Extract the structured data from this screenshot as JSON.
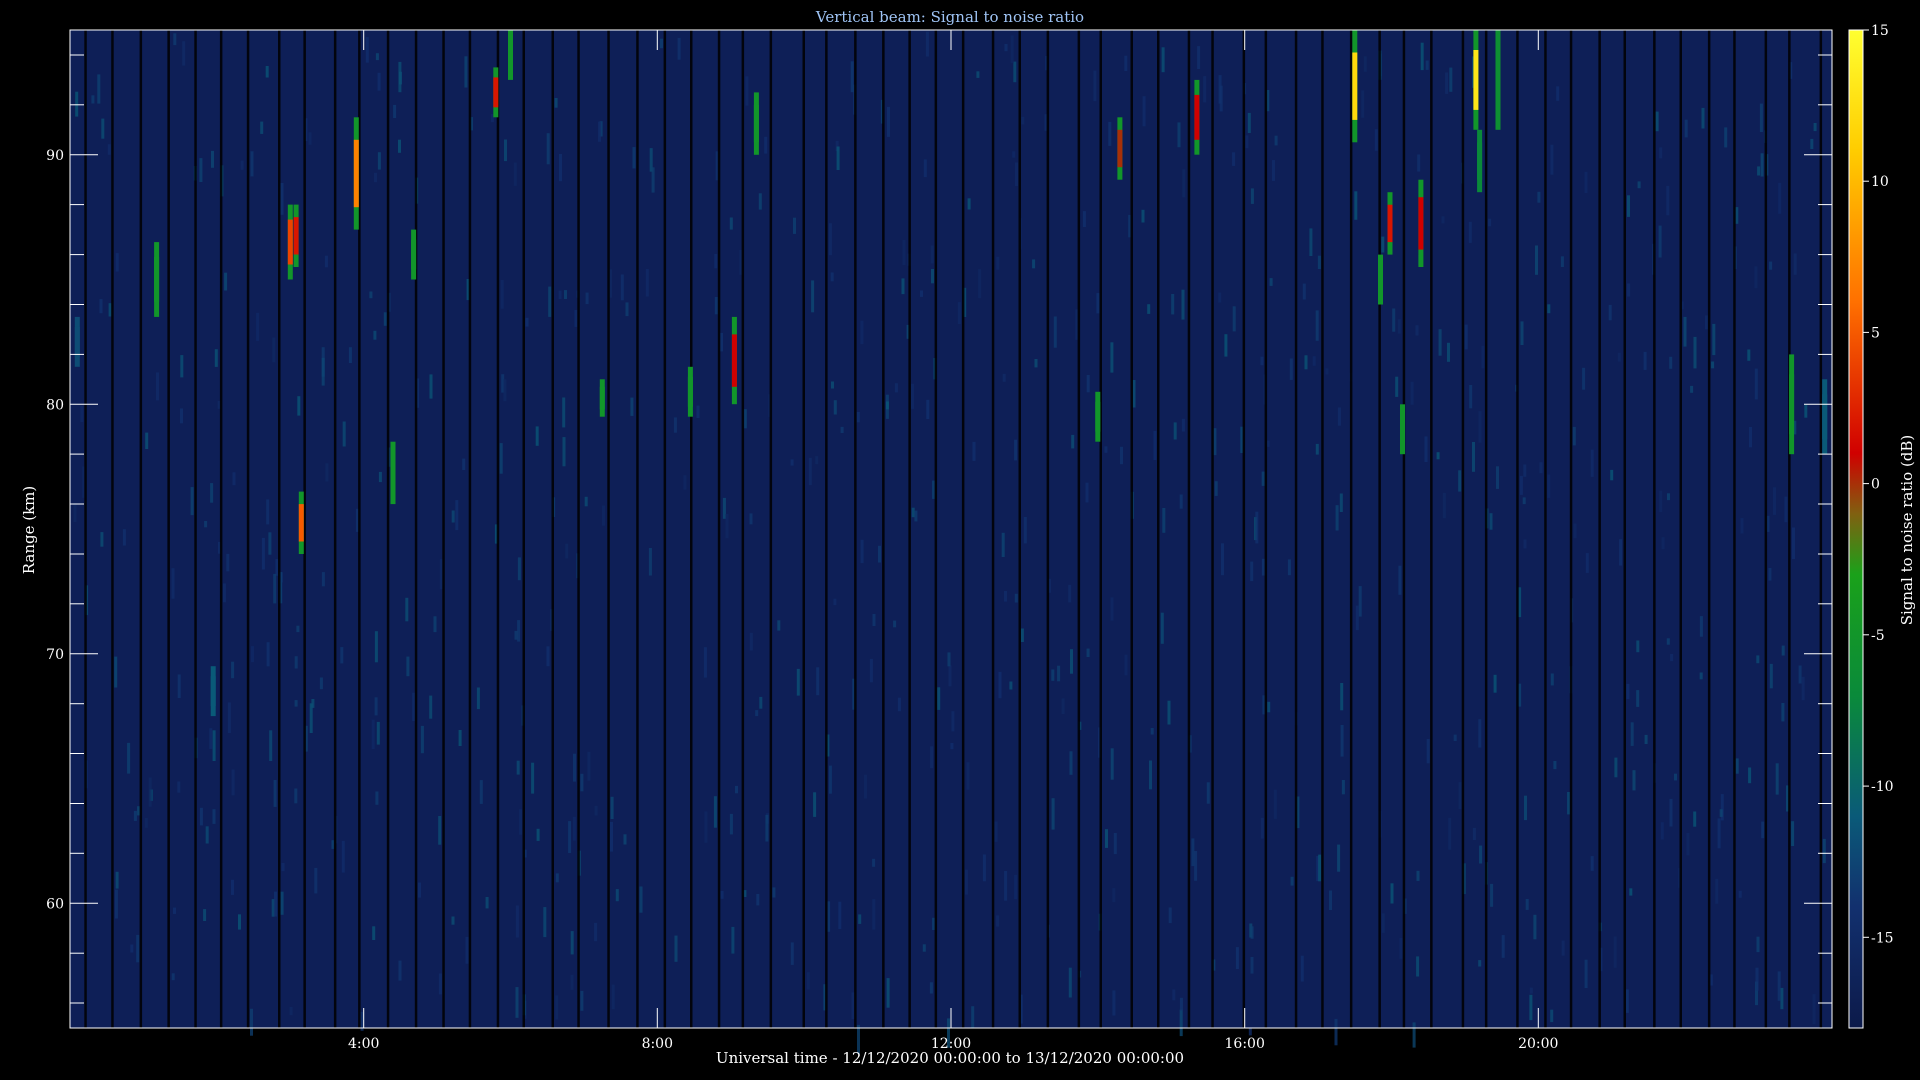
{
  "chart_data": {
    "type": "heatmap",
    "title": "Vertical beam: Signal to noise ratio",
    "xlabel": "Universal time - 12/12/2020 00:00:00 to 13/12/2020 00:00:00",
    "ylabel": "Range (km)",
    "colorbar_label": "Signal to noise ratio (dB)",
    "x_range_hours": [
      0,
      24
    ],
    "ylim": [
      55,
      95
    ],
    "clim": [
      -18,
      15
    ],
    "x_ticks": [
      {
        "hour": 4,
        "label": "4:00"
      },
      {
        "hour": 8,
        "label": "8:00"
      },
      {
        "hour": 12,
        "label": "12:00"
      },
      {
        "hour": 16,
        "label": "16:00"
      },
      {
        "hour": 20,
        "label": "20:00"
      }
    ],
    "y_ticks": [
      {
        "value": 60,
        "label": "60"
      },
      {
        "value": 70,
        "label": "70"
      },
      {
        "value": 80,
        "label": "80"
      },
      {
        "value": 90,
        "label": "90"
      }
    ],
    "colorbar_ticks": [
      {
        "value": 15,
        "label": "15"
      },
      {
        "value": 10,
        "label": "10"
      },
      {
        "value": 5,
        "label": "5"
      },
      {
        "value": 0,
        "label": "0"
      },
      {
        "value": -5,
        "label": "-5"
      },
      {
        "value": -10,
        "label": "-10"
      },
      {
        "value": -15,
        "label": "-15"
      }
    ],
    "colormap": [
      {
        "v": -18,
        "color": "#0c1a4a"
      },
      {
        "v": -14,
        "color": "#12306e"
      },
      {
        "v": -11,
        "color": "#0a5a78"
      },
      {
        "v": -7,
        "color": "#0a8a3a"
      },
      {
        "v": -3,
        "color": "#1aa11a"
      },
      {
        "v": -1,
        "color": "#806010"
      },
      {
        "v": 1,
        "color": "#d00000"
      },
      {
        "v": 6,
        "color": "#ff7000"
      },
      {
        "v": 11,
        "color": "#ffcc00"
      },
      {
        "v": 15,
        "color": "#ffff30"
      }
    ],
    "background_snr_db": -15,
    "echoes": [
      {
        "time_h": 0.1,
        "range_km": [
          81.5,
          83.5
        ],
        "snr_db": -12
      },
      {
        "time_h": 1.18,
        "range_km": [
          83.5,
          86.5
        ],
        "snr_db": -5
      },
      {
        "time_h": 1.95,
        "range_km": [
          67.5,
          69.5
        ],
        "snr_db": -11
      },
      {
        "time_h": 3.0,
        "range_km": [
          85,
          88
        ],
        "snr_db": 4
      },
      {
        "time_h": 3.08,
        "range_km": [
          85.5,
          88
        ],
        "snr_db": 2
      },
      {
        "time_h": 3.15,
        "range_km": [
          74,
          76.5
        ],
        "snr_db": 5
      },
      {
        "time_h": 3.9,
        "range_km": [
          87,
          91.5
        ],
        "snr_db": 7
      },
      {
        "time_h": 4.4,
        "range_km": [
          76,
          78.5
        ],
        "snr_db": -5
      },
      {
        "time_h": 4.68,
        "range_km": [
          85,
          87
        ],
        "snr_db": -5
      },
      {
        "time_h": 5.8,
        "range_km": [
          91.5,
          93.5
        ],
        "snr_db": 2
      },
      {
        "time_h": 6.0,
        "range_km": [
          93,
          95
        ],
        "snr_db": -5
      },
      {
        "time_h": 7.25,
        "range_km": [
          79.5,
          81
        ],
        "snr_db": -5
      },
      {
        "time_h": 8.45,
        "range_km": [
          79.5,
          81.5
        ],
        "snr_db": -5
      },
      {
        "time_h": 9.05,
        "range_km": [
          80,
          83.5
        ],
        "snr_db": 1
      },
      {
        "time_h": 9.35,
        "range_km": [
          90,
          92.5
        ],
        "snr_db": -5
      },
      {
        "time_h": 14.0,
        "range_km": [
          78.5,
          80.5
        ],
        "snr_db": -5
      },
      {
        "time_h": 14.3,
        "range_km": [
          89,
          91.5
        ],
        "snr_db": 0
      },
      {
        "time_h": 15.35,
        "range_km": [
          90,
          93
        ],
        "snr_db": 1
      },
      {
        "time_h": 17.5,
        "range_km": [
          90.5,
          95
        ],
        "snr_db": 12
      },
      {
        "time_h": 17.85,
        "range_km": [
          84,
          86
        ],
        "snr_db": -5
      },
      {
        "time_h": 17.98,
        "range_km": [
          86,
          88.5
        ],
        "snr_db": 2
      },
      {
        "time_h": 18.15,
        "range_km": [
          78,
          80
        ],
        "snr_db": -5
      },
      {
        "time_h": 18.4,
        "range_km": [
          85.5,
          89
        ],
        "snr_db": 1
      },
      {
        "time_h": 19.15,
        "range_km": [
          91,
          95
        ],
        "snr_db": 13
      },
      {
        "time_h": 19.2,
        "range_km": [
          88.5,
          91
        ],
        "snr_db": -7
      },
      {
        "time_h": 19.45,
        "range_km": [
          91,
          95
        ],
        "snr_db": -6
      },
      {
        "time_h": 23.45,
        "range_km": [
          78,
          82
        ],
        "snr_db": -5
      },
      {
        "time_h": 23.9,
        "range_km": [
          78,
          81
        ],
        "snr_db": -11
      }
    ]
  }
}
